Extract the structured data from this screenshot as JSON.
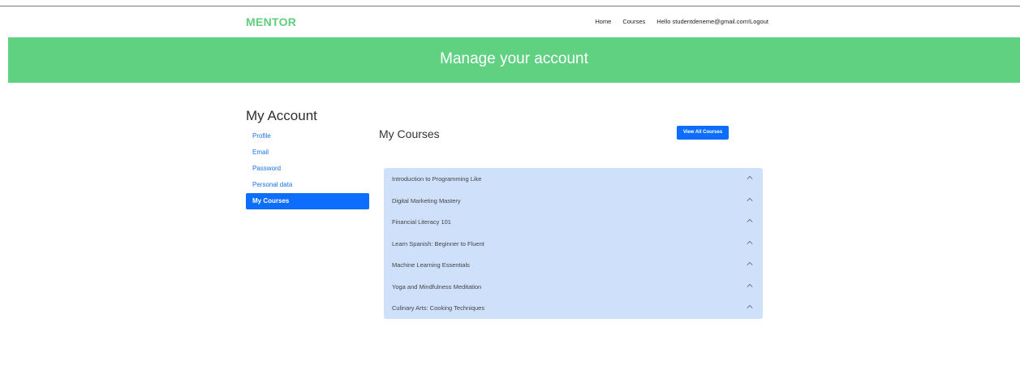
{
  "navbar": {
    "brand": "MENTOR",
    "links": {
      "home": "Home",
      "courses": "Courses",
      "greeting": "Hello studentdeneme@gmail.com!",
      "logout": "Logout"
    }
  },
  "hero": {
    "title": "Manage your account"
  },
  "sidebar": {
    "title": "My Account",
    "items": [
      {
        "label": "Profile"
      },
      {
        "label": "Email"
      },
      {
        "label": "Password"
      },
      {
        "label": "Personal data"
      },
      {
        "label": "My Courses",
        "active": true
      }
    ]
  },
  "main": {
    "title": "My Courses",
    "view_all_label": "View All Courses",
    "courses": [
      {
        "label": "Introduction to Programming Like"
      },
      {
        "label": "Digital Marketing Mastery"
      },
      {
        "label": "Financial Literacy 101"
      },
      {
        "label": "Learn Spanish: Beginner to Fluent"
      },
      {
        "label": "Machine Learning Essentials"
      },
      {
        "label": "Yoga and Mindfulness Meditation"
      },
      {
        "label": "Culinary Arts: Cooking Techniques"
      }
    ]
  },
  "colors": {
    "brand_green": "#5fce7f",
    "hero_green": "#5fd181",
    "primary_blue": "#0d6efd",
    "accordion_bg": "#cfe0fb"
  },
  "icons": {
    "course_toggle": "chevron-up-icon"
  }
}
